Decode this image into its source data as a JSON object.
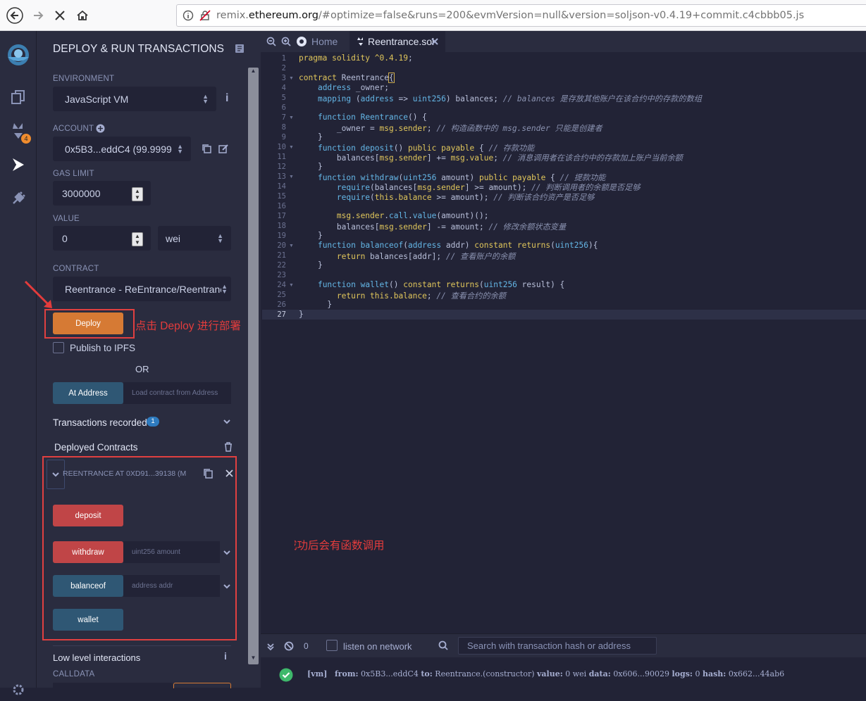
{
  "browser": {
    "url_prefix": "remix.",
    "url_domain": "ethereum.org",
    "url_rest": "/#optimize=false&runs=200&evmVersion=null&version=soljson-v0.4.19+commit.c4cbbb05.js"
  },
  "panel": {
    "title": "DEPLOY & RUN TRANSACTIONS",
    "environment_label": "ENVIRONMENT",
    "environment_value": "JavaScript VM",
    "account_label": "ACCOUNT",
    "account_value": "0x5B3...eddC4 (99.9999",
    "gas_limit_label": "GAS LIMIT",
    "gas_limit_value": "3000000",
    "value_label": "VALUE",
    "value_amount": "0",
    "value_unit": "wei",
    "contract_label": "CONTRACT",
    "contract_value": "Reentrance - ReEntrance/Reentranc",
    "deploy_label": "Deploy",
    "publish_label": "Publish to IPFS",
    "or_label": "OR",
    "at_address_label": "At Address",
    "at_address_placeholder": "Load contract from Address",
    "transactions_recorded_label": "Transactions recorded",
    "transactions_recorded_count": "1",
    "deployed_contracts_label": "Deployed Contracts",
    "deployed_instance": "REENTRANCE AT 0XD91...39138 (M",
    "functions": [
      {
        "label": "deposit",
        "placeholder": ""
      },
      {
        "label": "withdraw",
        "placeholder": "uint256 amount"
      },
      {
        "label": "balanceof",
        "placeholder": "address addr"
      },
      {
        "label": "wallet",
        "placeholder": ""
      }
    ],
    "low_level_label": "Low level interactions",
    "calldata_label": "CALLDATA"
  },
  "annotations": {
    "deploy_note": "点击 Deploy 进行部署",
    "functions_note": "部署成功后会有函数调用"
  },
  "editor": {
    "tabs": [
      {
        "label": "Home"
      },
      {
        "label": "Reentrance.sol"
      }
    ],
    "lines": [
      "1",
      "2",
      "3",
      "4",
      "5",
      "6",
      "7",
      "8",
      "9",
      "10",
      "11",
      "12",
      "13",
      "14",
      "15",
      "16",
      "17",
      "18",
      "19",
      "20",
      "21",
      "22",
      "23",
      "24",
      "25",
      "26",
      "27"
    ]
  },
  "terminal": {
    "pending_count": "0",
    "listen_label": "listen on network",
    "search_placeholder": "Search with transaction hash or address",
    "log_tag": "[vm]",
    "log_from_label": "from:",
    "log_from": "0x5B3...eddC4",
    "log_to_label": "to:",
    "log_to": "Reentrance.(constructor)",
    "log_value_label": "value:",
    "log_value": "0 wei",
    "log_data_label": "data:",
    "log_data": "0x606...90029",
    "log_logs_label": "logs:",
    "log_logs": "0",
    "log_hash_label": "hash:",
    "log_hash": "0x662...44ab6"
  },
  "colors": {
    "accent_orange": "#d67a34",
    "function_red": "#c04547",
    "function_blue": "#2f5774",
    "annotation_red": "#e43c3c",
    "success_green": "#3eb86b"
  }
}
